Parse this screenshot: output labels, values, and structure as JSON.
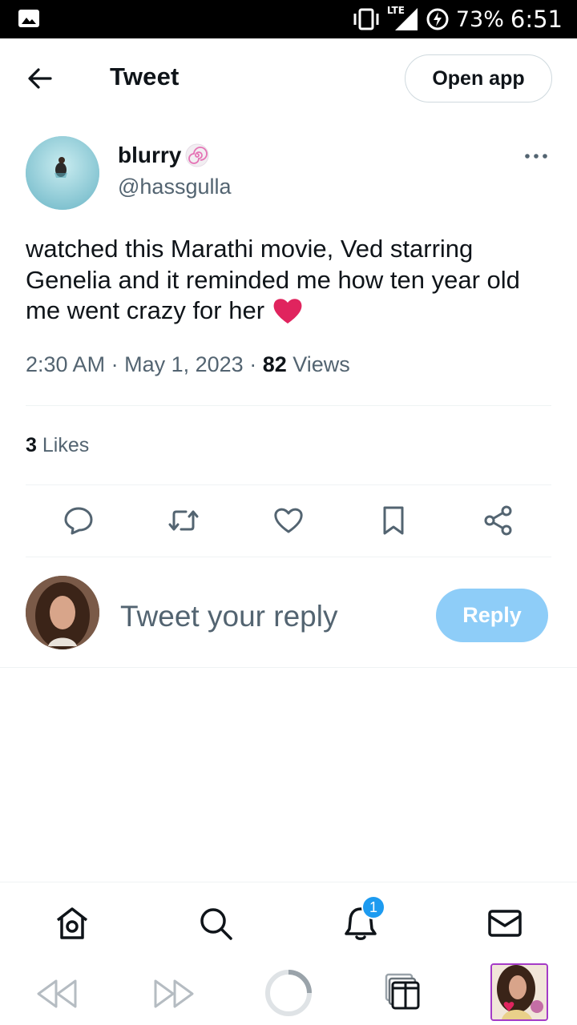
{
  "status_bar": {
    "network": "LTE",
    "battery": "73%",
    "time": "6:51"
  },
  "header": {
    "title": "Tweet",
    "open_app_label": "Open app"
  },
  "tweet": {
    "author_name": "blurry",
    "author_handle": "@hassgulla",
    "text": "watched this Marathi movie, Ved starring Genelia and it reminded me how ten year old me went crazy for her",
    "time": "2:30 AM",
    "date": "May 1, 2023",
    "views_count": "82",
    "views_label": "Views",
    "likes_count": "3",
    "likes_label": "Likes"
  },
  "reply": {
    "placeholder": "Tweet your reply",
    "button_label": "Reply"
  },
  "tabbar": {
    "notification_count": "1"
  },
  "colors": {
    "accent": "#1d9bf0",
    "reply_button_disabled": "#8ecdf8",
    "secondary_text": "#536471",
    "heart": "#e0245e",
    "tab_thumb_border": "#a43bc7"
  }
}
